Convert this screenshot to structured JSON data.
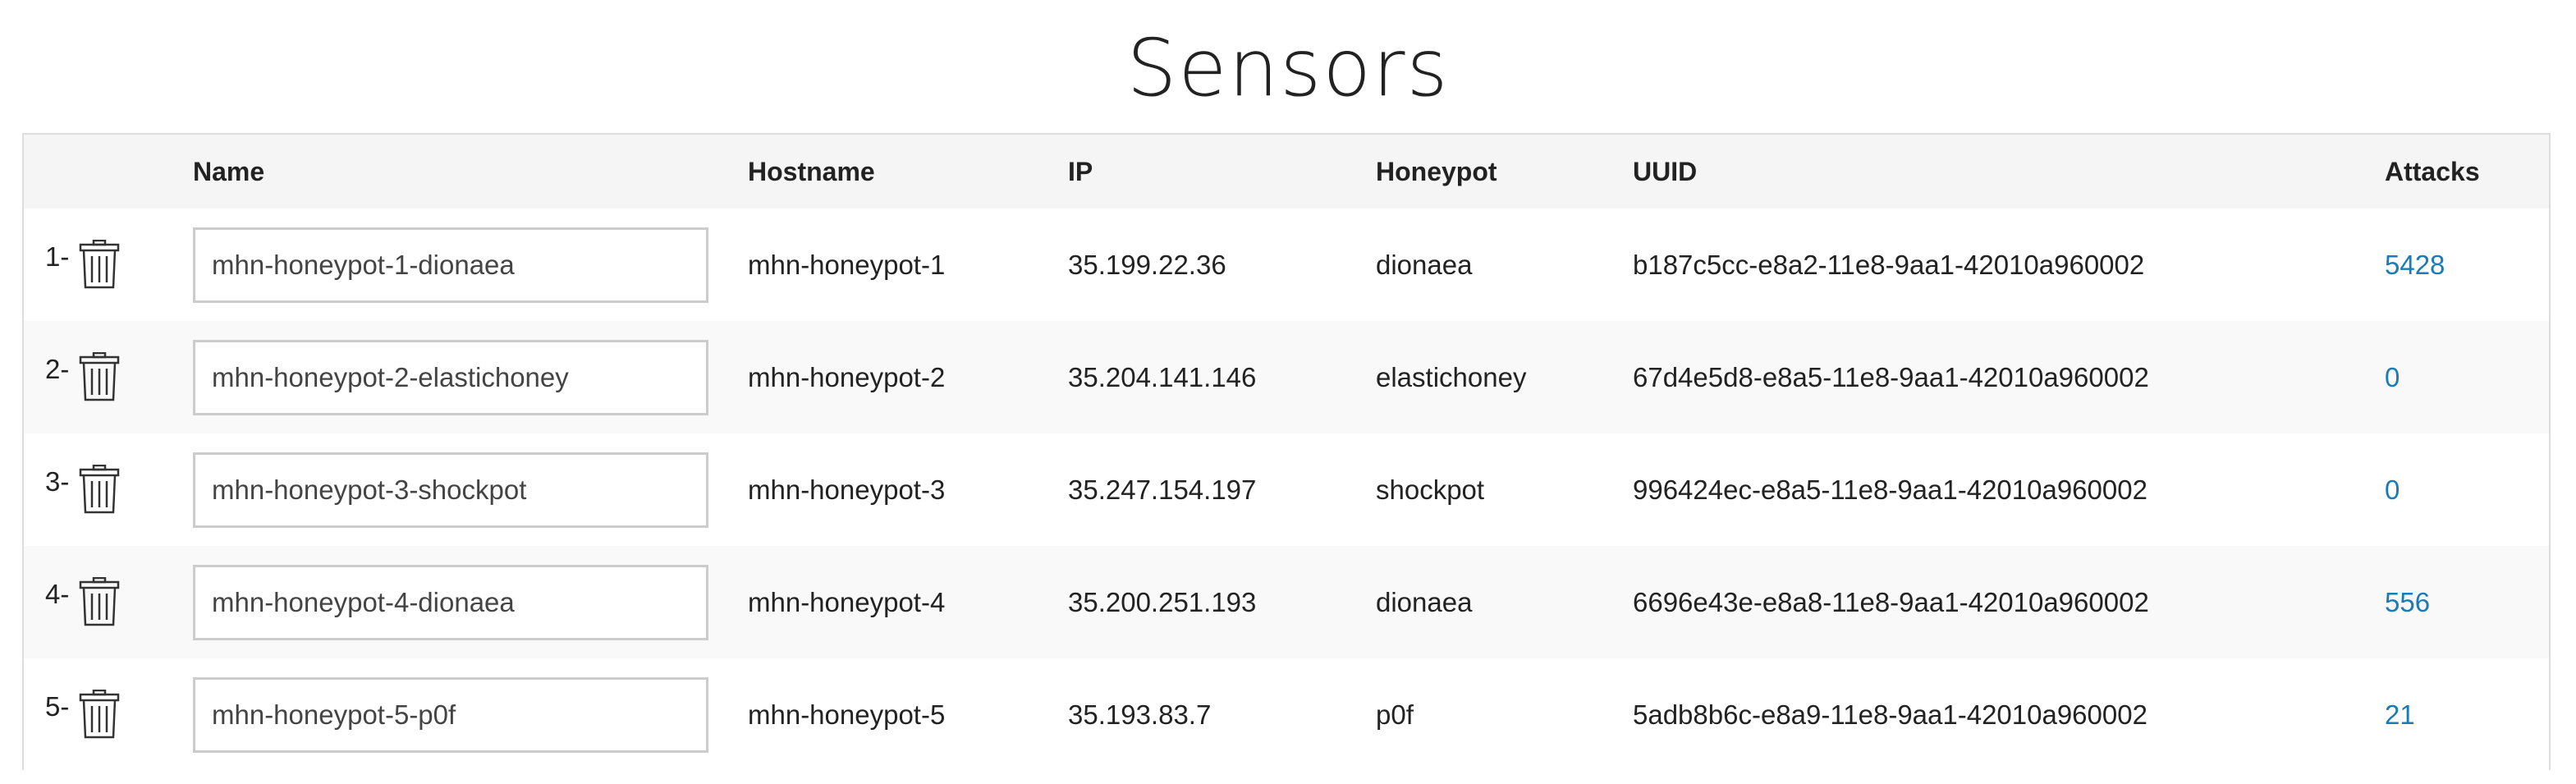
{
  "page": {
    "title": "Sensors"
  },
  "colors": {
    "link": "#1a7bb8",
    "header_bg": "#f5f5f5",
    "stripe_bg": "#f9f9f9",
    "border": "#dddddd"
  },
  "icons": {
    "delete": "trash-icon"
  },
  "table": {
    "headers": {
      "index": "",
      "name": "Name",
      "hostname": "Hostname",
      "ip": "IP",
      "honeypot": "Honeypot",
      "uuid": "UUID",
      "attacks": "Attacks"
    },
    "rows": [
      {
        "index": "1-",
        "name": "mhn-honeypot-1-dionaea",
        "hostname": "mhn-honeypot-1",
        "ip": "35.199.22.36",
        "honeypot": "dionaea",
        "uuid": "b187c5cc-e8a2-11e8-9aa1-42010a960002",
        "attacks": "5428"
      },
      {
        "index": "2-",
        "name": "mhn-honeypot-2-elastichoney",
        "hostname": "mhn-honeypot-2",
        "ip": "35.204.141.146",
        "honeypot": "elastichoney",
        "uuid": "67d4e5d8-e8a5-11e8-9aa1-42010a960002",
        "attacks": "0"
      },
      {
        "index": "3-",
        "name": "mhn-honeypot-3-shockpot",
        "hostname": "mhn-honeypot-3",
        "ip": "35.247.154.197",
        "honeypot": "shockpot",
        "uuid": "996424ec-e8a5-11e8-9aa1-42010a960002",
        "attacks": "0"
      },
      {
        "index": "4-",
        "name": "mhn-honeypot-4-dionaea",
        "hostname": "mhn-honeypot-4",
        "ip": "35.200.251.193",
        "honeypot": "dionaea",
        "uuid": "6696e43e-e8a8-11e8-9aa1-42010a960002",
        "attacks": "556"
      },
      {
        "index": "5-",
        "name": "mhn-honeypot-5-p0f",
        "hostname": "mhn-honeypot-5",
        "ip": "35.193.83.7",
        "honeypot": "p0f",
        "uuid": "5adb8b6c-e8a9-11e8-9aa1-42010a960002",
        "attacks": "21"
      }
    ]
  }
}
